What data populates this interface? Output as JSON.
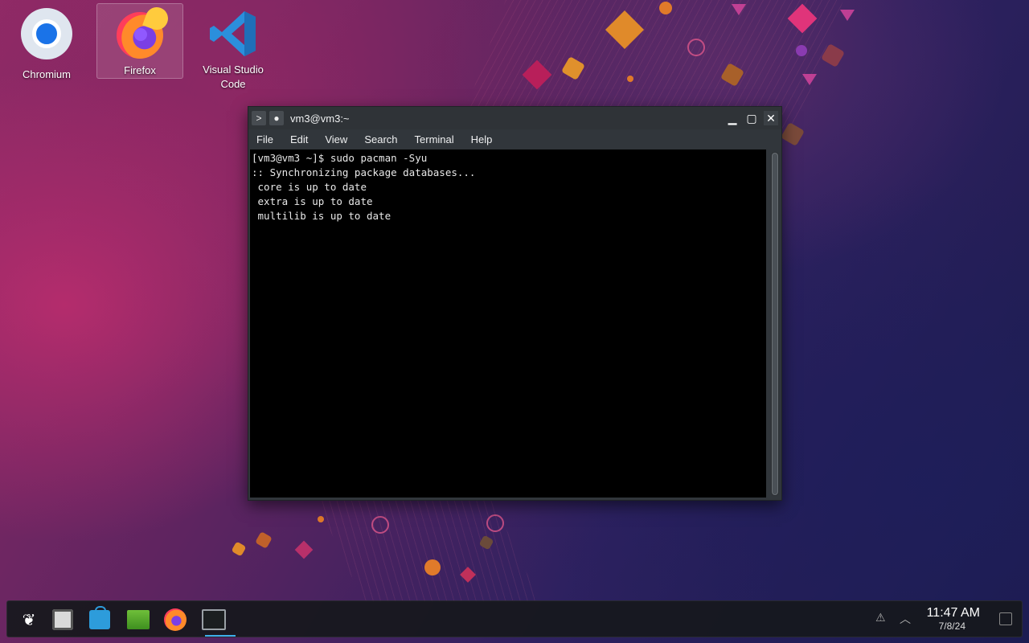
{
  "desktop": {
    "icons": [
      {
        "label": "Chromium",
        "icon": "chromium-icon"
      },
      {
        "label": "Firefox",
        "icon": "firefox-icon"
      },
      {
        "label": "Visual Studio Code",
        "icon": "vscode-icon"
      }
    ]
  },
  "window": {
    "title": "vm3@vm3:~",
    "menu": [
      "File",
      "Edit",
      "View",
      "Search",
      "Terminal",
      "Help"
    ],
    "controls": {
      "minimize": "minimize-icon",
      "maximize": "maximize-icon",
      "close": "close-icon"
    }
  },
  "terminal": {
    "lines": [
      "[vm3@vm3 ~]$ sudo pacman -Syu",
      ":: Synchronizing package databases...",
      " core is up to date",
      " extra is up to date",
      " multilib is up to date"
    ]
  },
  "taskbar": {
    "apps": [
      "application-launcher-icon",
      "image-viewer-icon",
      "software-store-icon",
      "file-manager-icon",
      "firefox-icon",
      "terminal-icon"
    ],
    "clock": {
      "time": "11:47 AM",
      "date": "7/8/24"
    }
  },
  "colors": {
    "accent": "#3daee9",
    "window_bg": "#31363b",
    "terminal_bg": "#000000",
    "terminal_fg": "#e8e8e8"
  }
}
